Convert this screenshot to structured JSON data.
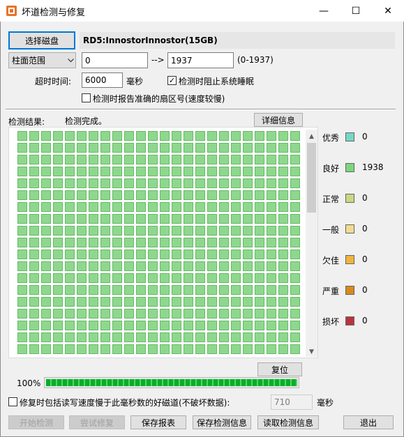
{
  "window": {
    "title": "坏道检测与修复",
    "min_glyph": "—",
    "max_glyph": "☐",
    "close_glyph": "✕"
  },
  "top": {
    "select_disk_label": "选择磁盘",
    "disk_name": "RD5:InnostorInnostor(15GB)",
    "range_mode": "柱面范围",
    "range_start": "0",
    "range_arrow": "-->",
    "range_end": "1937",
    "range_hint": "(0-1937)",
    "timeout_label": "超时时间:",
    "timeout_value": "6000",
    "timeout_unit": "毫秒",
    "prevent_sleep_label": "检测时阻止系统睡眠",
    "prevent_sleep_checked": true,
    "report_sector_label": "检测时报告准确的扇区号(速度较慢)",
    "report_sector_checked": false
  },
  "results": {
    "label": "检测结果:",
    "status": "检测完成。",
    "details_button": "详细信息",
    "reset_button": "复位",
    "cell_count": 1938,
    "cell_color": "#8ed88e"
  },
  "legend": [
    {
      "label": "优秀",
      "color": "#76d7c4",
      "count": "0"
    },
    {
      "label": "良好",
      "color": "#7dd67d",
      "count": "1938"
    },
    {
      "label": "正常",
      "color": "#c8d882",
      "count": "0"
    },
    {
      "label": "一般",
      "color": "#f0dc8c",
      "count": "0"
    },
    {
      "label": "欠佳",
      "color": "#f0b43c",
      "count": "0"
    },
    {
      "label": "严重",
      "color": "#d78a1e",
      "count": "0"
    },
    {
      "label": "损坏",
      "color": "#b9343c",
      "count": "0"
    }
  ],
  "progress": {
    "percent_label": "100%",
    "value": 1.0
  },
  "repair": {
    "option_label": "修复时包括读写速度慢于此毫秒数的好磁道(不破坏数据):",
    "option_checked": false,
    "ms_value": "710",
    "ms_unit": "毫秒"
  },
  "buttons": {
    "start": "开始检测",
    "try_repair": "尝试修复",
    "save_report": "保存报表",
    "save_info": "保存检测信息",
    "read_info": "读取检测信息",
    "exit": "退出"
  }
}
